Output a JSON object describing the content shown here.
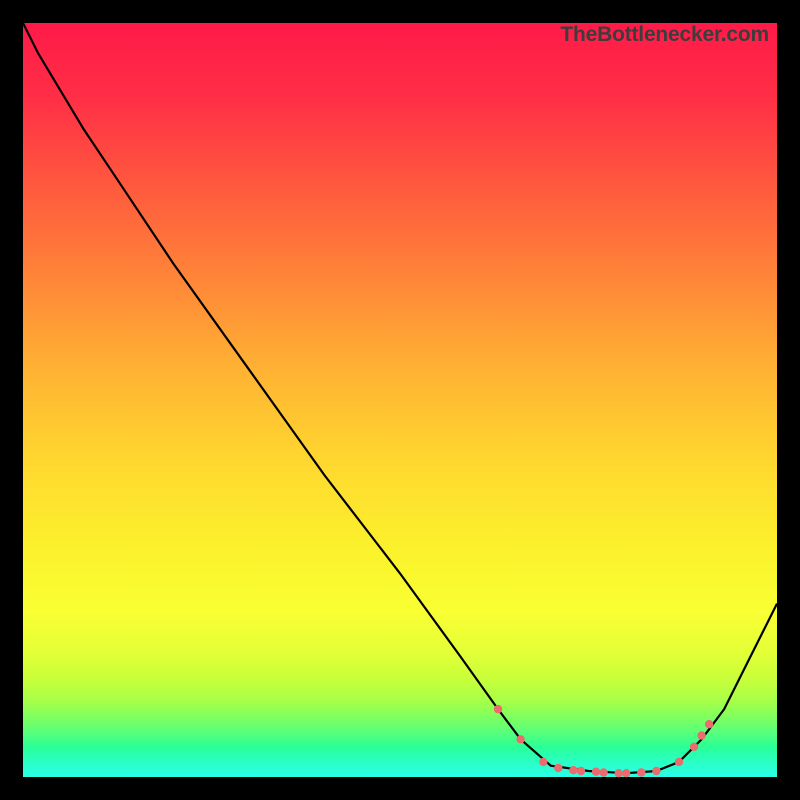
{
  "watermark": "TheBottleneсker.com",
  "colors": {
    "curve": "#000000",
    "dots": "#eb6b6e",
    "frame": "#000000"
  },
  "chart_data": {
    "type": "line",
    "title": "",
    "xlabel": "",
    "ylabel": "",
    "xlim": [
      0,
      100
    ],
    "ylim": [
      0,
      100
    ],
    "grid": false,
    "note": "Axis ticks are not shown; x and y values are normalized 0–100 estimates read from the plot geometry. The curve decreases steeply, flattens near y≈0 around x≈70–85, then rises again.",
    "series": [
      {
        "name": "curve",
        "x": [
          0,
          2,
          5,
          8,
          12,
          20,
          30,
          40,
          50,
          58,
          63,
          66,
          70,
          75,
          80,
          84,
          87,
          90,
          93,
          96,
          100
        ],
        "y": [
          100,
          96,
          91,
          86,
          80,
          68,
          54,
          40,
          27,
          16,
          9,
          5,
          1.5,
          0.8,
          0.5,
          0.8,
          2,
          5,
          9,
          15,
          23
        ]
      }
    ],
    "points": {
      "name": "highlight-dots",
      "note": "Small salmon dots along the low portion of the curve.",
      "x": [
        63,
        66,
        69,
        71,
        73,
        74,
        76,
        77,
        79,
        80,
        82,
        84,
        87,
        89,
        90,
        91
      ],
      "y": [
        9,
        5,
        2,
        1.2,
        0.9,
        0.8,
        0.7,
        0.6,
        0.5,
        0.5,
        0.6,
        0.8,
        2,
        4,
        5.5,
        7
      ]
    }
  }
}
